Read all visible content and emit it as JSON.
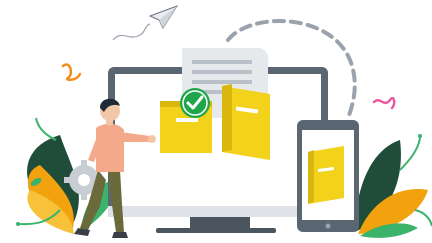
{
  "illustration": {
    "subject": "person-transferring-documents-from-desktop-to-phone",
    "icons": [
      "paper-plane-icon",
      "checkmark-icon",
      "gear-icon",
      "folder-icon",
      "document-icon"
    ],
    "colors": {
      "monitor": "#5b6673",
      "screen": "#ffffff",
      "folder": "#f2d21b",
      "folder_dark": "#d9b70c",
      "check_badge": "#1fa64a",
      "leaf_dark": "#1f4d3a",
      "leaf_green": "#3bb36b",
      "leaf_orange": "#f2a20c",
      "shirt": "#f3a98a",
      "pants": "#6b6a3a",
      "accent_pink": "#e85aa0",
      "accent_orange": "#f28c1a",
      "dash": "#9aa3ad"
    }
  }
}
